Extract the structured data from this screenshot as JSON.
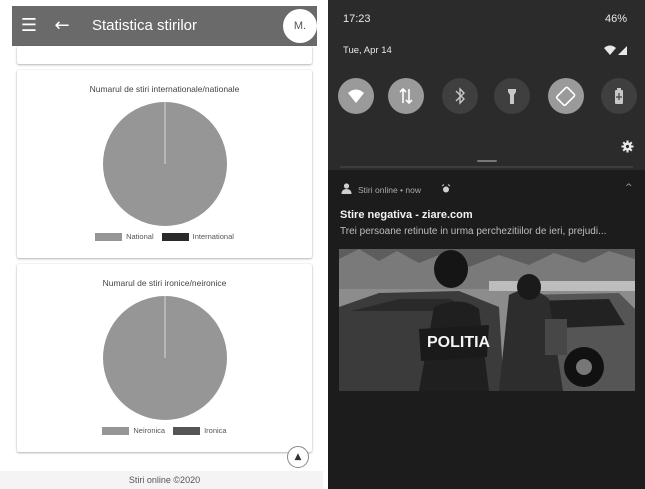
{
  "app": {
    "title": "Statistica stirilor",
    "avatar_text": "M.",
    "footer": "Stiri online ©2020"
  },
  "charts": [
    {
      "title": "Numarul de stiri internationale/nationale",
      "legend": [
        {
          "label": "National",
          "color": "#969696"
        },
        {
          "label": "International",
          "color": "#2b2b2b"
        }
      ]
    },
    {
      "title": "Numarul de stiri ironice/neironice",
      "legend": [
        {
          "label": "Neironica",
          "color": "#969696"
        },
        {
          "label": "Ironica",
          "color": "#555555"
        }
      ]
    }
  ],
  "chart_data": [
    {
      "type": "pie",
      "title": "Numarul de stiri internationale/nationale",
      "labels": [
        "National",
        "International"
      ],
      "values": [
        1,
        0
      ]
    },
    {
      "type": "pie",
      "title": "Numarul de stiri ironice/neironice",
      "labels": [
        "Neironica",
        "Ironica"
      ],
      "values": [
        1,
        0
      ]
    }
  ],
  "status_bar": {
    "time": "17:23",
    "battery": "46%",
    "date": "Tue, Apr 14"
  },
  "quick_settings": [
    {
      "name": "wifi",
      "state": "on"
    },
    {
      "name": "mobile-data",
      "state": "off"
    },
    {
      "name": "bluetooth",
      "state": "off"
    },
    {
      "name": "flashlight",
      "state": "off"
    },
    {
      "name": "auto-rotate",
      "state": "on"
    },
    {
      "name": "battery-saver",
      "state": "off"
    }
  ],
  "notification": {
    "app_name": "Stiri online",
    "time": "now",
    "header": "Stiri online • now",
    "title": "Stire negativa - ziare.com",
    "body": "Trei persoane retinute in urma perchezitiilor de ieri, prejudi...",
    "image_text": "POLITIA"
  },
  "colors": {
    "app_bar": "#6a6a6a",
    "pie_primary": "#969696",
    "shade_background": "#2b2b2b",
    "notification_background": "#1c1c1c"
  }
}
